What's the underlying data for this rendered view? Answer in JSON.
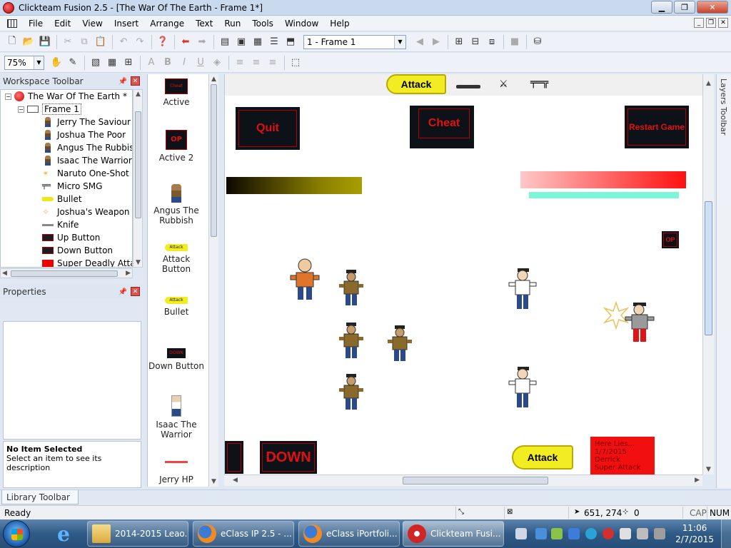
{
  "window": {
    "title": "Clickteam Fusion 2.5 - [The War Of The Earth - Frame 1*]"
  },
  "menu": [
    "File",
    "Edit",
    "View",
    "Insert",
    "Arrange",
    "Text",
    "Run",
    "Tools",
    "Window",
    "Help"
  ],
  "toolbar": {
    "frame_select": "1 - Frame 1",
    "zoom": "75%"
  },
  "workspace": {
    "title": "Workspace Toolbar",
    "tree": {
      "root": "The War Of The Earth *",
      "frame": "Frame 1",
      "items": [
        {
          "label": "Jerry The Saviour",
          "icon": "person-icon"
        },
        {
          "label": "Joshua The Poor",
          "icon": "person-icon"
        },
        {
          "label": "Angus The Rubbish",
          "icon": "person-icon"
        },
        {
          "label": "Isaac The Warrior",
          "icon": "person-icon"
        },
        {
          "label": "Naruto One-Shot",
          "icon": "star-icon"
        },
        {
          "label": "Micro SMG",
          "icon": "gun-icon"
        },
        {
          "label": "Bullet",
          "icon": "bullet-icon"
        },
        {
          "label": "Joshua's Weapon",
          "icon": "weapon-icon"
        },
        {
          "label": "Knife",
          "icon": "knife-icon"
        },
        {
          "label": "Up Button",
          "icon": "dark-button-icon"
        },
        {
          "label": "Down Button",
          "icon": "dark-button-icon"
        },
        {
          "label": "Super Deadly Attacl",
          "icon": "red-box-icon"
        }
      ]
    }
  },
  "properties": {
    "title": "Properties",
    "desc_title": "No Item Selected",
    "desc_text": "Select an item to see its description"
  },
  "objects": [
    {
      "label": "Active",
      "thumb_text": "Cheat"
    },
    {
      "label": "Active 2",
      "thumb_text": "OP"
    },
    {
      "label": "Angus The Rubbish",
      "thumb_text": ""
    },
    {
      "label": "Attack Button",
      "thumb_text": "Attack"
    },
    {
      "label": "Bullet",
      "thumb_text": "Attack"
    },
    {
      "label": "Down Button",
      "thumb_text": "DOWN"
    },
    {
      "label": "Isaac The Warrior",
      "thumb_text": ""
    },
    {
      "label": "Jerry HP",
      "thumb_text": ""
    }
  ],
  "frame": {
    "attack_top": "Attack",
    "quit": "Quit",
    "cheat": "Cheat",
    "restart": "Restart Game",
    "op": "OP",
    "down": "DOWN",
    "attack_bottom": "Attack",
    "note": "Here Lies...\n1/7/2015\nDerrick\nSuper Attack"
  },
  "layers_toolbar": "Layers Toolbar",
  "library_toolbar": "Library Toolbar",
  "status": {
    "text": "Ready",
    "coords": "651, 274",
    "count": "0",
    "cap": "CAP",
    "num": "NUM"
  },
  "taskbar": {
    "tasks": [
      "2014-2015 Leao...",
      "eClass IP 2.5 - ...",
      "eClass iPortfoli...",
      "Clickteam Fusi..."
    ],
    "time": "11:06",
    "date": "2/7/2015"
  },
  "colors": {
    "accent": "#f2ec23",
    "button_bg": "#0d1219",
    "button_text": "#e01010",
    "hp_cyan": "#7ef5d6",
    "note_red": "#f20f0f"
  }
}
